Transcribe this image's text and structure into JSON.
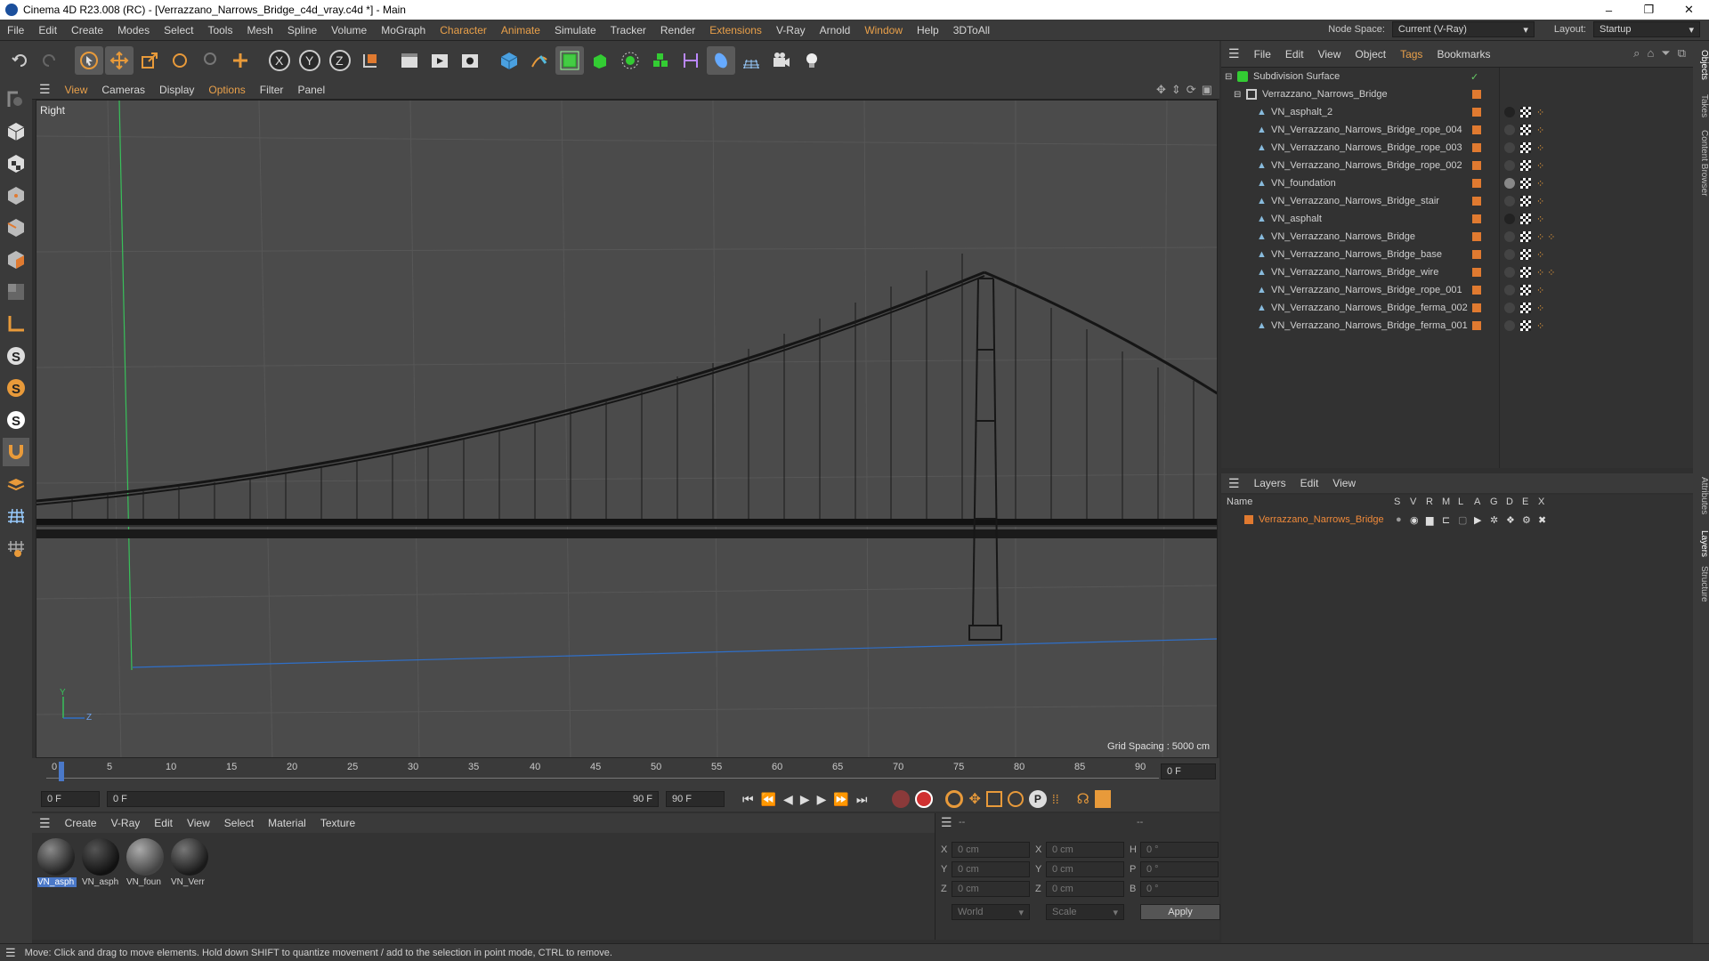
{
  "window": {
    "title": "Cinema 4D R23.008 (RC) - [Verrazzano_Narrows_Bridge_c4d_vray.c4d *] - Main",
    "min": "–",
    "max": "❐",
    "close": "✕"
  },
  "menubar": {
    "items": [
      "File",
      "Edit",
      "Create",
      "Modes",
      "Select",
      "Tools",
      "Mesh",
      "Spline",
      "Volume",
      "MoGraph",
      "Character",
      "Animate",
      "Simulate",
      "Tracker",
      "Render",
      "Extensions",
      "V-Ray",
      "Arnold",
      "Window",
      "Help",
      "3DToAll"
    ],
    "node_space_label": "Node Space:",
    "node_space_value": "Current (V-Ray)",
    "layout_label": "Layout:",
    "layout_value": "Startup"
  },
  "viewport": {
    "menu": [
      "View",
      "Cameras",
      "Display",
      "Options",
      "Filter",
      "Panel"
    ],
    "view_name": "Right",
    "grid_spacing": "Grid Spacing : 5000 cm",
    "axis_y": "Y",
    "axis_z": "Z"
  },
  "timeline": {
    "ticks": [
      "0",
      "5",
      "10",
      "15",
      "20",
      "25",
      "30",
      "35",
      "40",
      "45",
      "50",
      "55",
      "60",
      "65",
      "70",
      "75",
      "80",
      "85",
      "90"
    ],
    "end_frame_field": "0 F",
    "current_frame": "0 F",
    "range_start": "0 F",
    "range_end": "90 F",
    "max_frame": "90 F"
  },
  "materials": {
    "menu": [
      "Create",
      "V-Ray",
      "Edit",
      "View",
      "Select",
      "Material",
      "Texture"
    ],
    "items": [
      "VN_asph",
      "VN_asph",
      "VN_foun",
      "VN_Verr"
    ]
  },
  "coords": {
    "header_left": "--",
    "header_right": "--",
    "rows": [
      {
        "a": "X",
        "av": "0 cm",
        "b": "X",
        "bv": "0 cm",
        "c": "H",
        "cv": "0 °"
      },
      {
        "a": "Y",
        "av": "0 cm",
        "b": "Y",
        "bv": "0 cm",
        "c": "P",
        "cv": "0 °"
      },
      {
        "a": "Z",
        "av": "0 cm",
        "b": "Z",
        "bv": "0 cm",
        "c": "B",
        "cv": "0 °"
      }
    ],
    "world": "World",
    "scale": "Scale",
    "apply": "Apply"
  },
  "objects": {
    "menu": [
      "File",
      "Edit",
      "View",
      "Object",
      "Tags",
      "Bookmarks"
    ],
    "root": "Subdivision Surface",
    "group": "Verrazzano_Narrows_Bridge",
    "children": [
      "VN_asphalt_2",
      "VN_Verrazzano_Narrows_Bridge_rope_004",
      "VN_Verrazzano_Narrows_Bridge_rope_003",
      "VN_Verrazzano_Narrows_Bridge_rope_002",
      "VN_foundation",
      "VN_Verrazzano_Narrows_Bridge_stair",
      "VN_asphalt",
      "VN_Verrazzano_Narrows_Bridge",
      "VN_Verrazzano_Narrows_Bridge_base",
      "VN_Verrazzano_Narrows_Bridge_wire",
      "VN_Verrazzano_Narrows_Bridge_rope_001",
      "VN_Verrazzano_Narrows_Bridge_ferma_002",
      "VN_Verrazzano_Narrows_Bridge_ferma_001"
    ]
  },
  "layers": {
    "menu": [
      "Layers",
      "Edit",
      "View"
    ],
    "col_name": "Name",
    "cols": [
      "S",
      "V",
      "R",
      "M",
      "L",
      "A",
      "G",
      "D",
      "E",
      "X"
    ],
    "items": [
      "Verrazzano_Narrows_Bridge"
    ]
  },
  "sidetabs": [
    "Objects",
    "Takes",
    "Content Browser",
    "Attributes",
    "Layers",
    "Structure"
  ],
  "status": "Move: Click and drag to move elements. Hold down SHIFT to quantize movement / add to the selection in point mode, CTRL to remove.",
  "colors": {
    "accent_orange": "#e07a30",
    "layer_name": "#f08a3a",
    "selection_blue": "#4a78c8"
  }
}
